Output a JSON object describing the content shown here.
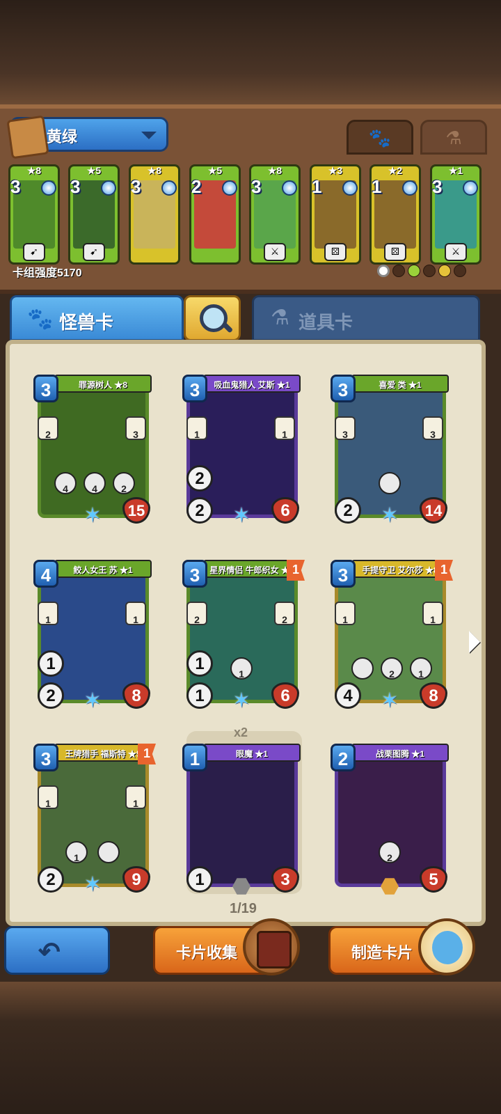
{
  "deck": {
    "name": "黄绿",
    "power_label": "卡组强度5170",
    "tabs": [
      {
        "name": "monster-filter",
        "icon": "paw-icon",
        "active": true
      },
      {
        "name": "item-filter",
        "icon": "potion-icon",
        "active": false
      }
    ],
    "cards": [
      {
        "stars": "★8",
        "cost": "3",
        "color": "#7dbf2f",
        "art": "#4f8a2a",
        "tag": "bow"
      },
      {
        "stars": "★5",
        "cost": "3",
        "color": "#7dbf2f",
        "art": "#3b6a2a",
        "tag": "bow"
      },
      {
        "stars": "★8",
        "cost": "3",
        "color": "#d8c22a",
        "art": "#c9b45a",
        "tag": ""
      },
      {
        "stars": "★5",
        "cost": "2",
        "color": "#7dbf2f",
        "art": "#c44a3a",
        "tag": ""
      },
      {
        "stars": "★8",
        "cost": "3",
        "color": "#7dbf2f",
        "art": "#5aa64a",
        "tag": "sword"
      },
      {
        "stars": "★3",
        "cost": "1",
        "color": "#d8c22a",
        "art": "#8a6a2a",
        "tag": "dice"
      },
      {
        "stars": "★2",
        "cost": "1",
        "color": "#d8c22a",
        "art": "#8a6a2a",
        "tag": "dice"
      },
      {
        "stars": "★1",
        "cost": "3",
        "color": "#7dbf2f",
        "art": "#3a9a8a",
        "tag": "sword"
      }
    ]
  },
  "tabs": {
    "monster": "怪兽卡",
    "item": "道具卡"
  },
  "collection": {
    "cards": [
      {
        "name": "罪源树人 ★8",
        "cost": "3",
        "atk": "",
        "hp": "15",
        "color": "#6aa62a",
        "art": "#3f6a22",
        "frame": "#5a8a2a",
        "bottom": "star",
        "flag": "",
        "abils": [
          "2",
          "3"
        ],
        "mids": [
          "4",
          "4",
          "2"
        ]
      },
      {
        "name": "吸血鬼猎人 艾斯 ★1",
        "cost": "3",
        "atk": "2",
        "atk2": "2",
        "hp": "6",
        "color": "#7a4ac8",
        "art": "#2a1e5a",
        "frame": "#5a3a9a",
        "bottom": "star",
        "flag": "",
        "abils": [
          "1",
          "1"
        ],
        "mids": []
      },
      {
        "name": "喜爱 类 ★1",
        "cost": "3",
        "atk": "2",
        "hp": "14",
        "color": "#6aa62a",
        "art": "#3a5a7a",
        "frame": "#5a8a2a",
        "bottom": "star",
        "flag": "",
        "abils": [
          "3",
          "3"
        ],
        "mids": [
          ""
        ]
      },
      {
        "name": "鲛人女王 苏 ★1",
        "cost": "4",
        "atk": "1",
        "atk2": "2",
        "hp": "8",
        "color": "#6aa62a",
        "art": "#2a4a8a",
        "frame": "#5a8a2a",
        "bottom": "star",
        "flag": "",
        "abils": [
          "1",
          "1"
        ],
        "mids": []
      },
      {
        "name": "星界情侣 牛郎织女 ★1",
        "cost": "3",
        "atk": "1",
        "atk2": "1",
        "hp": "6",
        "color": "#6aa62a",
        "art": "#2a6a5a",
        "frame": "#5a8a2a",
        "bottom": "star",
        "flag": "1",
        "abils": [
          "2",
          "2"
        ],
        "mids": [
          "1"
        ]
      },
      {
        "name": "手提守卫 艾尔莎 ★8",
        "cost": "3",
        "atk": "4",
        "hp": "8",
        "color": "#d8b82a",
        "art": "#5a8a4a",
        "frame": "#a88a2a",
        "bottom": "star",
        "flag": "1",
        "abils": [
          "1",
          "1"
        ],
        "mids": [
          "",
          "2",
          "1"
        ]
      },
      {
        "name": "王牌猎手 福斯特 ★5",
        "cost": "3",
        "atk": "2",
        "hp": "9",
        "color": "#d8b82a",
        "art": "#4a6a3a",
        "frame": "#a88a2a",
        "bottom": "star",
        "flag": "1",
        "abils": [
          "1",
          "1"
        ],
        "mids": [
          "1",
          ""
        ]
      },
      {
        "name": "眼魔 ★1",
        "cost": "1",
        "atk": "1",
        "hp": "3",
        "color": "#7a4ac8",
        "art": "#2a1e4a",
        "frame": "#5a3a9a",
        "bottom": "hex",
        "flag": "",
        "abils": [],
        "mids": []
      },
      {
        "name": "战栗图腾 ★1",
        "cost": "2",
        "atk": "",
        "hp": "5",
        "color": "#7a4ac8",
        "art": "#3a1e4a",
        "frame": "#5a3a9a",
        "bottom": "hexgold",
        "flag": "",
        "abils": [],
        "mids": [
          "2"
        ]
      }
    ],
    "copies_badge": "x2",
    "page": "1/19"
  },
  "buttons": {
    "collect": "卡片收集",
    "craft": "制造卡片"
  }
}
